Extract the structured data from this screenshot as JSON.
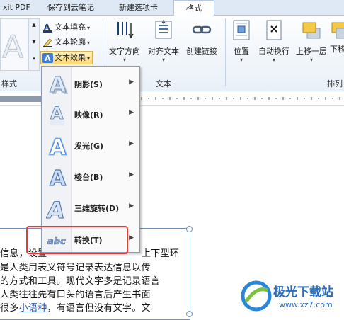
{
  "tabs": [
    {
      "label": "xit PDF"
    },
    {
      "label": "保存到云笔记"
    },
    {
      "label": "新建选项卡"
    },
    {
      "label": "格式"
    }
  ],
  "ribbon": {
    "styles_group_label": "样式",
    "text_fill": "文本填充",
    "text_outline": "文本轮廓",
    "text_effects": "文本效果",
    "text_direction": "文字方向",
    "align_text": "对齐文本",
    "create_link": "创建链接",
    "text_group_label": "文本",
    "position": "位置",
    "wrap_text": "自动换行",
    "bring_forward": "上移一层",
    "send_backward": "下移",
    "arrange_group_label": "排列"
  },
  "menu": {
    "items": [
      {
        "label": "阴影(S)",
        "icon": "shadow-a-icon"
      },
      {
        "label": "映像(R)",
        "icon": "reflection-a-icon"
      },
      {
        "label": "发光(G)",
        "icon": "glow-a-icon"
      },
      {
        "label": "棱台(B)",
        "icon": "bevel-a-icon"
      },
      {
        "label": "三维旋转(D)",
        "icon": "3d-rotation-a-icon"
      },
      {
        "label": "转换(T)",
        "icon": "transform-abc-icon"
      }
    ]
  },
  "document": {
    "lines": [
      "信息，设置",
      "是人类用表义符号记录表达信息以传",
      "的方式和工具。现代文字多是记录语言",
      "人类往往先有口头的语言后产生书面",
      "很多",
      "小语种",
      "，有语言但没有文字。文"
    ],
    "line1_right": "上下型环"
  },
  "watermark": {
    "brand": "极光下载站",
    "url": "www.xz7.com"
  },
  "colors": {
    "tab_bg": "#dfe9f5",
    "highlight_border": "#e23b3b",
    "link": "#2b55b0"
  }
}
